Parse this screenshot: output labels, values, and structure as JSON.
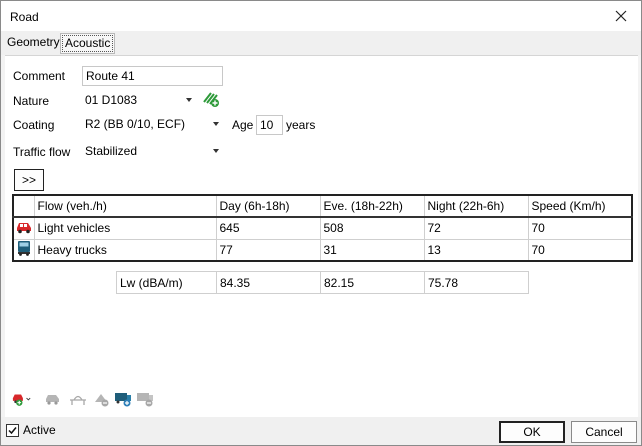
{
  "window": {
    "title": "Road"
  },
  "tabs": [
    {
      "label": "Geometry"
    },
    {
      "label": "Acoustic"
    }
  ],
  "form": {
    "comment_label": "Comment",
    "comment_value": "Route 41",
    "nature_label": "Nature",
    "nature_value": "01 D1083",
    "coating_label": "Coating",
    "coating_value": "R2 (BB 0/10, ECF)",
    "age_label": "Age",
    "age_value": "10",
    "age_unit": "years",
    "traffic_label": "Traffic flow",
    "traffic_value": "Stabilized",
    "expand_label": ">>"
  },
  "flow_table": {
    "headers": [
      "Flow (veh./h)",
      "Day (6h-18h)",
      "Eve. (18h-22h)",
      "Night (22h-6h)",
      "Speed (Km/h)"
    ],
    "rows": [
      {
        "icon": "car-icon",
        "name": "Light vehicles",
        "day": "645",
        "eve": "508",
        "night": "72",
        "speed": "70"
      },
      {
        "icon": "truck-icon",
        "name": "Heavy trucks",
        "day": "77",
        "eve": "31",
        "night": "13",
        "speed": "70"
      }
    ]
  },
  "lw_table": {
    "label": "Lw (dBA/m)",
    "day": "84.35",
    "eve": "82.15",
    "night": "75.78"
  },
  "toolbar": {
    "icons": [
      "add-vehicle-icon",
      "edit-vehicle-icon",
      "bridge-icon",
      "delete-vehicle-icon",
      "add-truck-icon",
      "delete-truck-icon"
    ]
  },
  "footer": {
    "active_label": "Active",
    "active_checked": true,
    "ok_label": "OK",
    "cancel_label": "Cancel"
  },
  "colors": {
    "car": "#d8282b",
    "truck": "#1f5e7a",
    "nature_icon": "#2e9a3a"
  }
}
